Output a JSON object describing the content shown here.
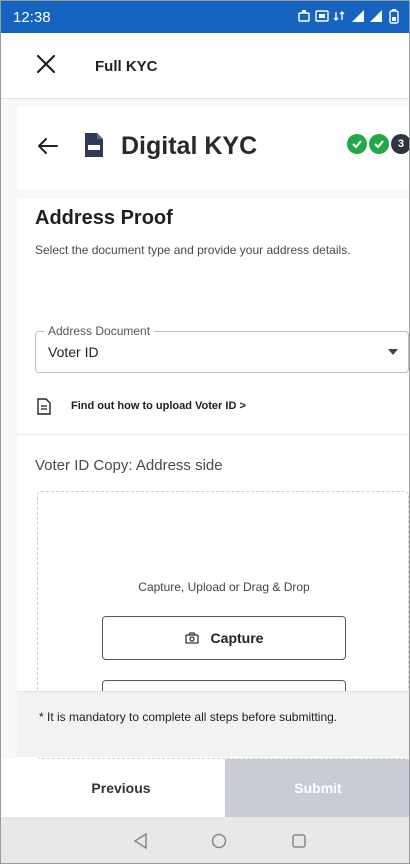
{
  "status_bar": {
    "time": "12:38"
  },
  "app_header": {
    "title": "Full KYC"
  },
  "kyc_header": {
    "title": "Digital KYC",
    "step_current": "3"
  },
  "section": {
    "title": "Address Proof",
    "description": "Select the document type and provide your address details."
  },
  "address_document": {
    "legend": "Address Document",
    "value": "Voter ID"
  },
  "help_link": {
    "label": "Find out how to upload Voter ID >"
  },
  "copy_section": {
    "label": "Voter ID Copy: Address side"
  },
  "upload_area": {
    "hint": "Capture, Upload or Drag & Drop",
    "capture_label": "Capture"
  },
  "notice": {
    "text": "* It is mandatory to complete all steps before submitting."
  },
  "footer": {
    "previous_label": "Previous",
    "submit_label": "Submit"
  },
  "colors": {
    "status_bar": "#1565c0",
    "step_done": "#22a84a",
    "step_current": "#2f3240",
    "submit_disabled": "#c9ccd5"
  }
}
